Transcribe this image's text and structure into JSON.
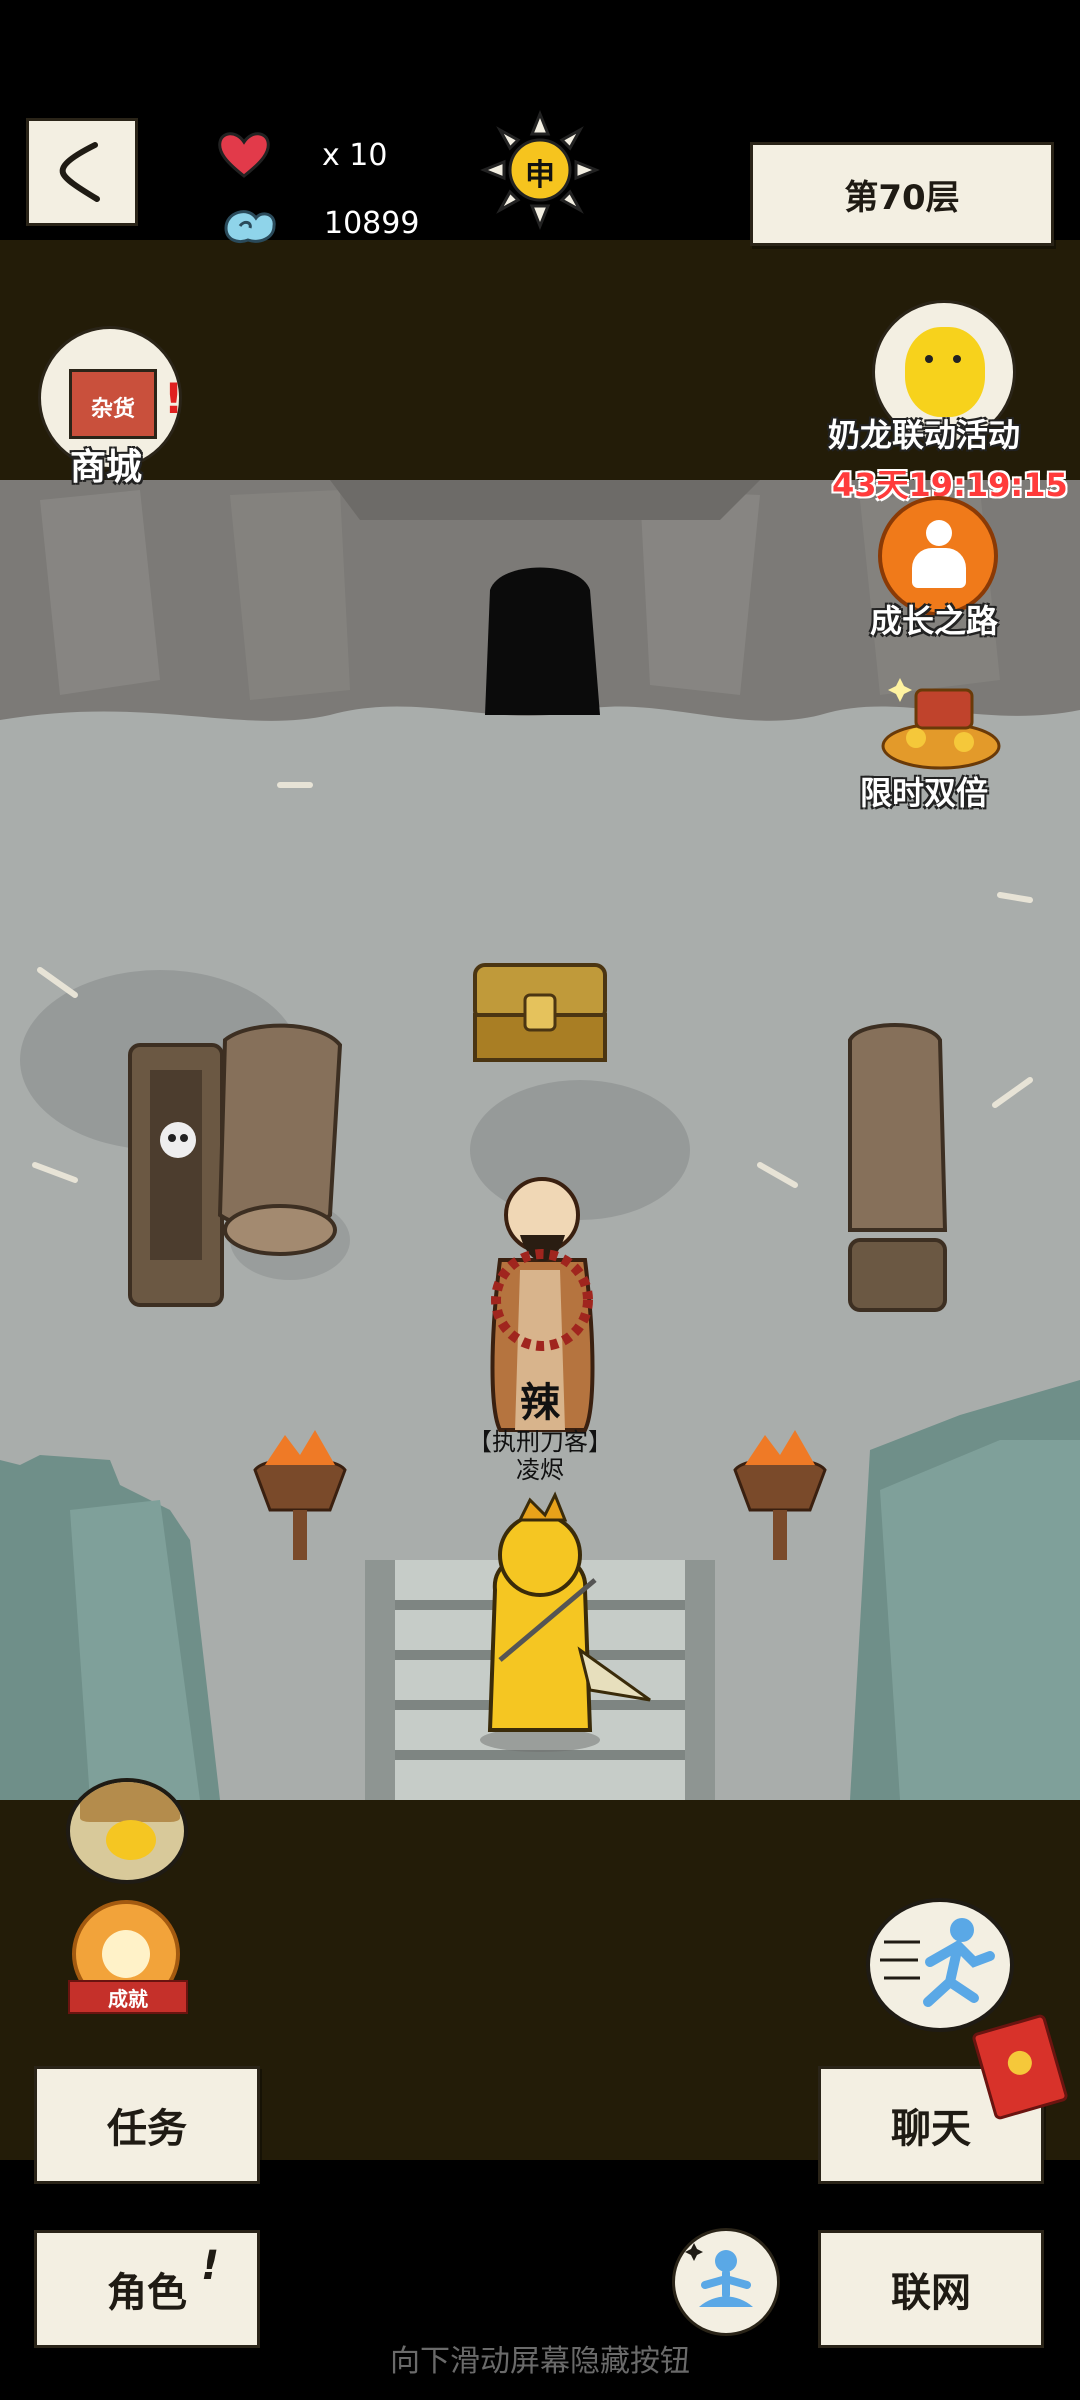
{
  "header": {
    "back_icon": "chevron-left-icon",
    "lives_icon": "heart-icon",
    "lives_label": "x 10",
    "currency_icon": "cloud-swirl-icon",
    "currency_value": "10899",
    "time_icon": "sun-shen-icon",
    "time_glyph": "申",
    "floor_label": "第70层"
  },
  "left_side": {
    "shop_label": "商城",
    "shop_sign": "杂货"
  },
  "right_side": {
    "event_label": "奶龙联动活动",
    "event_timer": "43天19:19:15",
    "growth_label": "成长之路",
    "double_label": "限时双倍"
  },
  "scene": {
    "npc_seal": "辣",
    "npc_title": "【执刑刀客】",
    "npc_name": "凌烬"
  },
  "bottom_left": {
    "achievement_label": "成就"
  },
  "buttons": {
    "tasks": "任务",
    "character": "角色",
    "character_badge": "!",
    "chat": "聊天",
    "network": "联网"
  },
  "hint": "向下滑动屏幕隐藏按钮",
  "colors": {
    "olive_band": "#231c08",
    "paper": "#f3efe2",
    "timer_red": "#ff3b3b",
    "floor_stone": "#a9adab"
  }
}
